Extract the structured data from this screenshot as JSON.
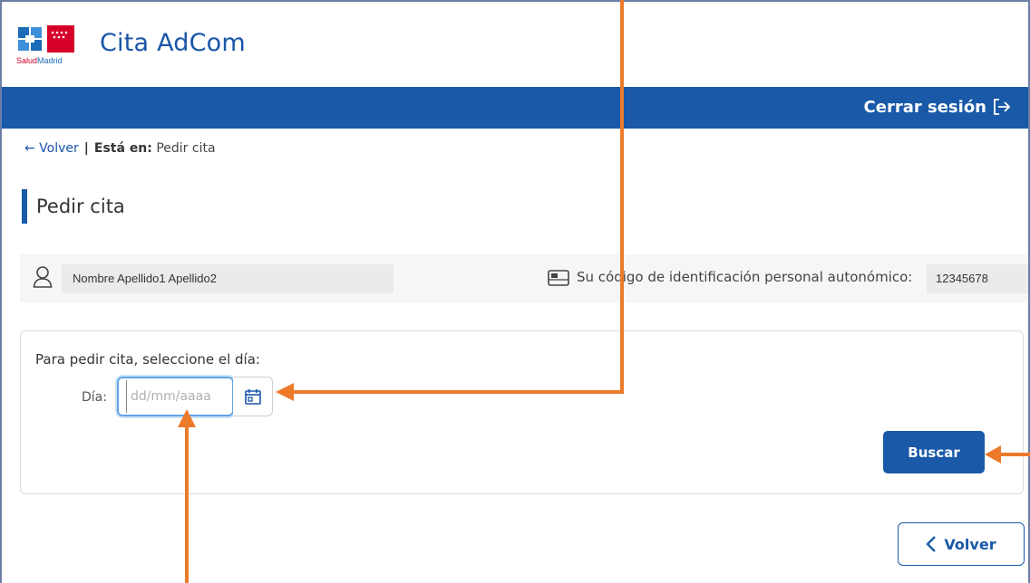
{
  "header": {
    "logo_text_a": "Salud",
    "logo_text_b": "Madrid",
    "app_title": "Cita AdCom"
  },
  "topbar": {
    "logout_label": "Cerrar sesión"
  },
  "breadcrumb": {
    "back_label": "← Volver",
    "separator": "|",
    "here_label": "Está en:",
    "current": "Pedir cita"
  },
  "page": {
    "title": "Pedir cita"
  },
  "user": {
    "name": "Nombre Apellido1 Apellido2",
    "code_label": "Su código de identificación personal autonómico:",
    "code_value": "12345678"
  },
  "form": {
    "instruction": "Para pedir cita, seleccione el día:",
    "day_label": "Día:",
    "date_placeholder": "dd/mm/aaaa",
    "date_value": "",
    "search_label": "Buscar"
  },
  "footer": {
    "back_button_label": "Volver"
  },
  "colors": {
    "brand_blue": "#1959a8",
    "annotation_orange": "#ec7a2b"
  },
  "icons": {
    "user": "user-icon",
    "card": "id-card-icon",
    "calendar": "calendar-icon",
    "logout": "logout-icon",
    "back": "chevron-left-icon"
  }
}
